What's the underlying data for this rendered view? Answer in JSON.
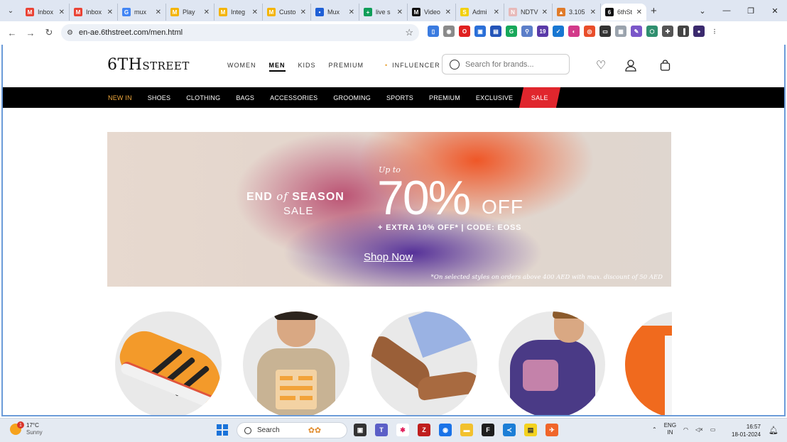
{
  "browser": {
    "tabs": [
      {
        "title": "Inbox",
        "fav": "M",
        "favcolor": "#ea4335"
      },
      {
        "title": "Inbox",
        "fav": "M",
        "favcolor": "#ea4335"
      },
      {
        "title": "mux",
        "fav": "G",
        "favcolor": "#4285f4"
      },
      {
        "title": "Play",
        "fav": "M",
        "favcolor": "#f4b400"
      },
      {
        "title": "Integ",
        "fav": "M",
        "favcolor": "#f4b400"
      },
      {
        "title": "Custo",
        "fav": "M",
        "favcolor": "#f4b400"
      },
      {
        "title": "Mux",
        "fav": "•",
        "favcolor": "#1f5fd6"
      },
      {
        "title": "live s",
        "fav": "+",
        "favcolor": "#0f9d58"
      },
      {
        "title": "Video",
        "fav": "M",
        "favcolor": "#111111"
      },
      {
        "title": "Admi",
        "fav": "S",
        "favcolor": "#f2d00f"
      },
      {
        "title": "NDTV",
        "fav": "N",
        "favcolor": "#e7b9b9"
      },
      {
        "title": "3.105",
        "fav": "▲",
        "favcolor": "#e07b2a"
      },
      {
        "title": "6thSt",
        "fav": "6",
        "favcolor": "#111111"
      }
    ],
    "url": "en-ae.6thstreet.com/men.html"
  },
  "site": {
    "logo_main": "6TH",
    "logo_tail": "STREET",
    "gender_nav": [
      "WOMEN",
      "MEN",
      "KIDS",
      "PREMIUM"
    ],
    "influencer": "INFLUENCER",
    "search_placeholder": "Search for brands...",
    "categories": [
      "NEW IN",
      "SHOES",
      "CLOTHING",
      "BAGS",
      "ACCESSORIES",
      "GROOMING",
      "SPORTS",
      "PREMIUM",
      "EXCLUSIVE"
    ],
    "sale_label": "SALE"
  },
  "banner": {
    "end_prefix": "END",
    "end_of": "of",
    "end_suffix": "SEASON",
    "sale": "SALE",
    "up_to": "Up to",
    "percent": "70%",
    "off": "OFF",
    "extra": "+ EXTRA 10% OFF*  |  CODE: EOSS",
    "cta": "Shop Now",
    "note": "*On selected styles on orders above 400 AED with max. discount of 50 AED"
  },
  "taskbar": {
    "weather_temp": "17°C",
    "weather_desc": "Sunny",
    "weather_badge": "1",
    "search_label": "Search",
    "lang_1": "ENG",
    "lang_2": "IN",
    "time": "16:57",
    "date": "18-01-2024"
  }
}
